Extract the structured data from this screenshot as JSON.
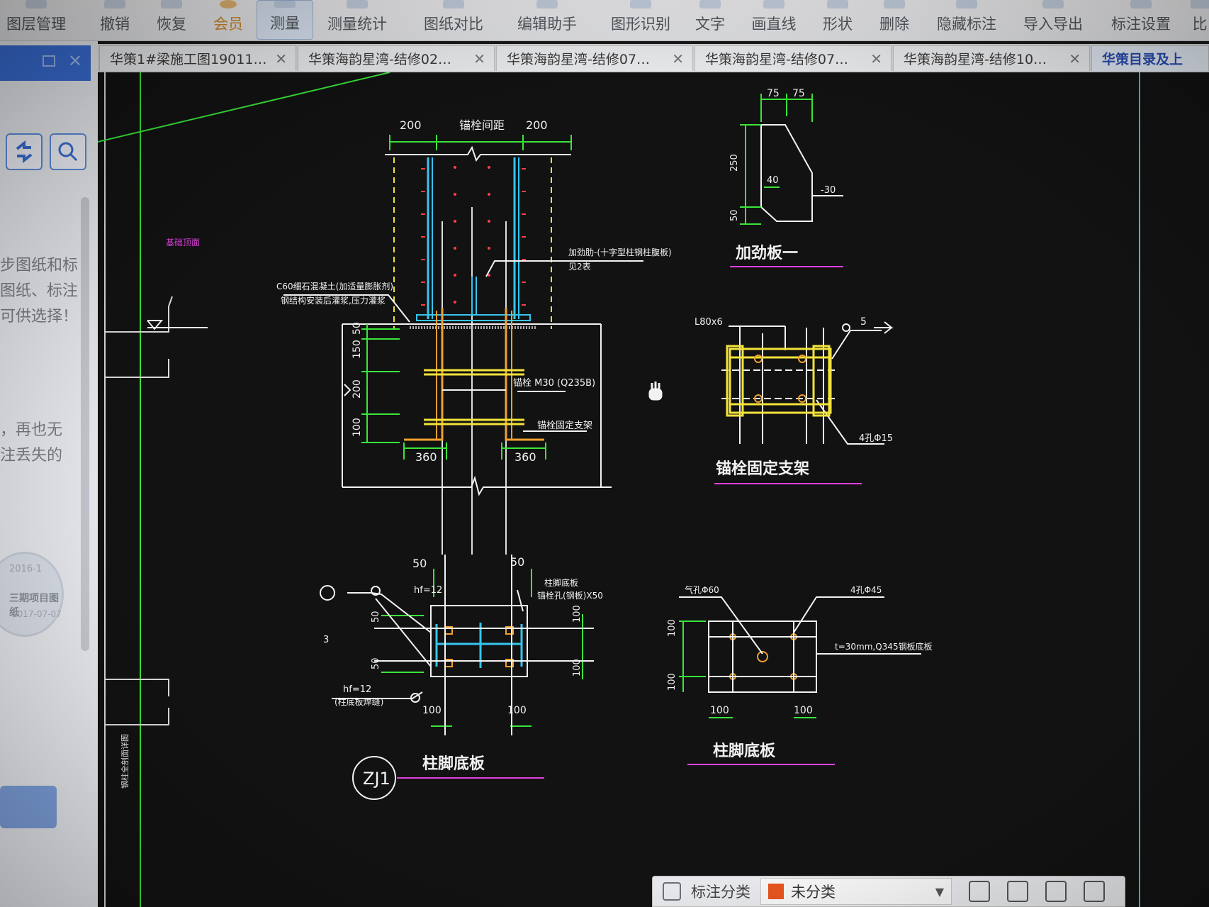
{
  "toolbar": {
    "items": [
      {
        "label": "图层管理"
      },
      {
        "label": "撤销"
      },
      {
        "label": "恢复"
      },
      {
        "label": "会员"
      },
      {
        "label": "测量"
      },
      {
        "label": "测量统计"
      },
      {
        "label": "图纸对比"
      },
      {
        "label": "编辑助手"
      },
      {
        "label": "图形识别"
      },
      {
        "label": "文字"
      },
      {
        "label": "画直线"
      },
      {
        "label": "形状"
      },
      {
        "label": "删除"
      },
      {
        "label": "隐藏标注"
      },
      {
        "label": "导入导出"
      },
      {
        "label": "标注设置"
      },
      {
        "label": "比"
      }
    ],
    "active_item": "测量"
  },
  "tabs": [
    {
      "title": "华策1#梁施工图19011…"
    },
    {
      "title": "华策海韵星湾-结修02…"
    },
    {
      "title": "华策海韵星湾-结修07…"
    },
    {
      "title": "华策海韵星湾-结修07…"
    },
    {
      "title": "华策海韵星湾-结修10…"
    },
    {
      "title": "华策目录及上"
    }
  ],
  "left_panel": {
    "text_lines_1": [
      "步图纸和标",
      "图纸、标注",
      "可供选择！"
    ],
    "text_lines_2": [
      "，再也无",
      "注丢失的"
    ],
    "badge": {
      "date1": "2016-1",
      "project": "三期项目图纸",
      "date2": "2017-07-07"
    }
  },
  "drawing": {
    "labels": {
      "dim_200_left": "200",
      "dim_200_right": "200",
      "anchor_top": "锚栓间距",
      "stiff_dim_75a": "75",
      "stiff_dim_75b": "75",
      "stiff_250": "250",
      "stiff_40": "40",
      "stiff_minus30": "-30",
      "stiff_50": "50",
      "stiffener_title": "加劲板一",
      "note_right": "加劲肋-(十字型柱钢柱腹板)",
      "note_right2": "见2表",
      "grout_note1": "C60细石混凝土(加适量膨胀剂)",
      "grout_note2": "钢结构安装后灌浆,压力灌浆",
      "dim_50": "50",
      "dim_150": "150",
      "dim_200": "200",
      "dim_100": "100",
      "dim_360a": "360",
      "dim_360b": "360",
      "anchor_note": "锚栓 M30 (Q235B)",
      "bracket_note": "锚栓固定支架",
      "l_steel": "L80x6",
      "hole_note": "4孔Φ15",
      "five": "5",
      "bracket_title": "锚栓固定支架",
      "elev_mark": "基础顶面",
      "plan_50a": "50",
      "plan_50b": "50",
      "hf12": "hf=12",
      "col_note1": "柱脚底板",
      "col_note2": "锚栓孔(钢板)X50",
      "plan_50c": "50",
      "plan_50d": "50",
      "plan_100a": "100",
      "plan_100b": "100",
      "plan_100c": "100",
      "plan_100d": "100",
      "hf12b": "hf=12",
      "weld_note": "(柱底板焊缝)",
      "three": "3",
      "zj1": "ZJ1",
      "base_title_left": "柱脚底板",
      "hole_note2": "气孔Φ60",
      "hole_note3": "4孔Φ45",
      "plate_note": "t=30mm,Q345钢板底板",
      "bp_100a": "100",
      "bp_100b": "100",
      "bp_100c": "100",
      "bp_100d": "100",
      "base_title_right": "柱脚底板",
      "left_vertical": "钢柱全剖面详图"
    }
  },
  "floatbar": {
    "label": "标注分类",
    "selected": "未分类",
    "swatch_color": "#e4531f"
  },
  "colors": {
    "cad_bg": "#121212",
    "green": "#39e639",
    "white": "#f2f2f2",
    "yellow": "#f3e23a",
    "cyan": "#35c6f0",
    "red": "#ff4040",
    "magenta": "#e040e0",
    "orange": "#f0a030"
  }
}
